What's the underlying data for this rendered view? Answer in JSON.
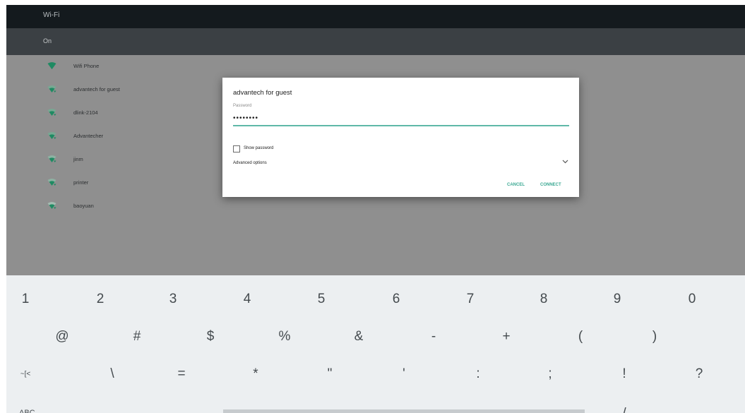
{
  "header": {
    "title": "Wi-Fi"
  },
  "wifi_toggle": {
    "label": "On"
  },
  "networks": [
    {
      "name": "Wifi Phone",
      "strength": 4
    },
    {
      "name": "advantech for guest",
      "strength": 3
    },
    {
      "name": "dlink-2104",
      "strength": 3
    },
    {
      "name": "Advantecher",
      "strength": 3
    },
    {
      "name": "jinm",
      "strength": 2
    },
    {
      "name": "printer",
      "strength": 2
    },
    {
      "name": "baoyuan",
      "strength": 1
    }
  ],
  "dialog": {
    "title": "advantech for guest",
    "password_label": "Password",
    "password_value": "••••••••",
    "show_password_label": "Show password",
    "show_password_checked": false,
    "advanced_label": "Advanced options",
    "cancel_label": "CANCEL",
    "connect_label": "CONNECT"
  },
  "keyboard": {
    "row1": [
      "1",
      "2",
      "3",
      "4",
      "5",
      "6",
      "7",
      "8",
      "9",
      "0"
    ],
    "row2": [
      "@",
      "#",
      "$",
      "%",
      "&",
      "-",
      "+",
      "(",
      ")"
    ],
    "row3": [
      "~[<",
      "\\",
      "=",
      "*",
      "\"",
      "'",
      ":",
      ";",
      "!",
      "?"
    ],
    "mode_key": "ABC",
    "row4_right": "/"
  },
  "colors": {
    "accent": "#3aa892",
    "wifi_icon": "#1f8a62",
    "header_bg": "#141a1e",
    "list_bg": "#8f8f8f",
    "keyboard_bg": "#eceff1"
  }
}
